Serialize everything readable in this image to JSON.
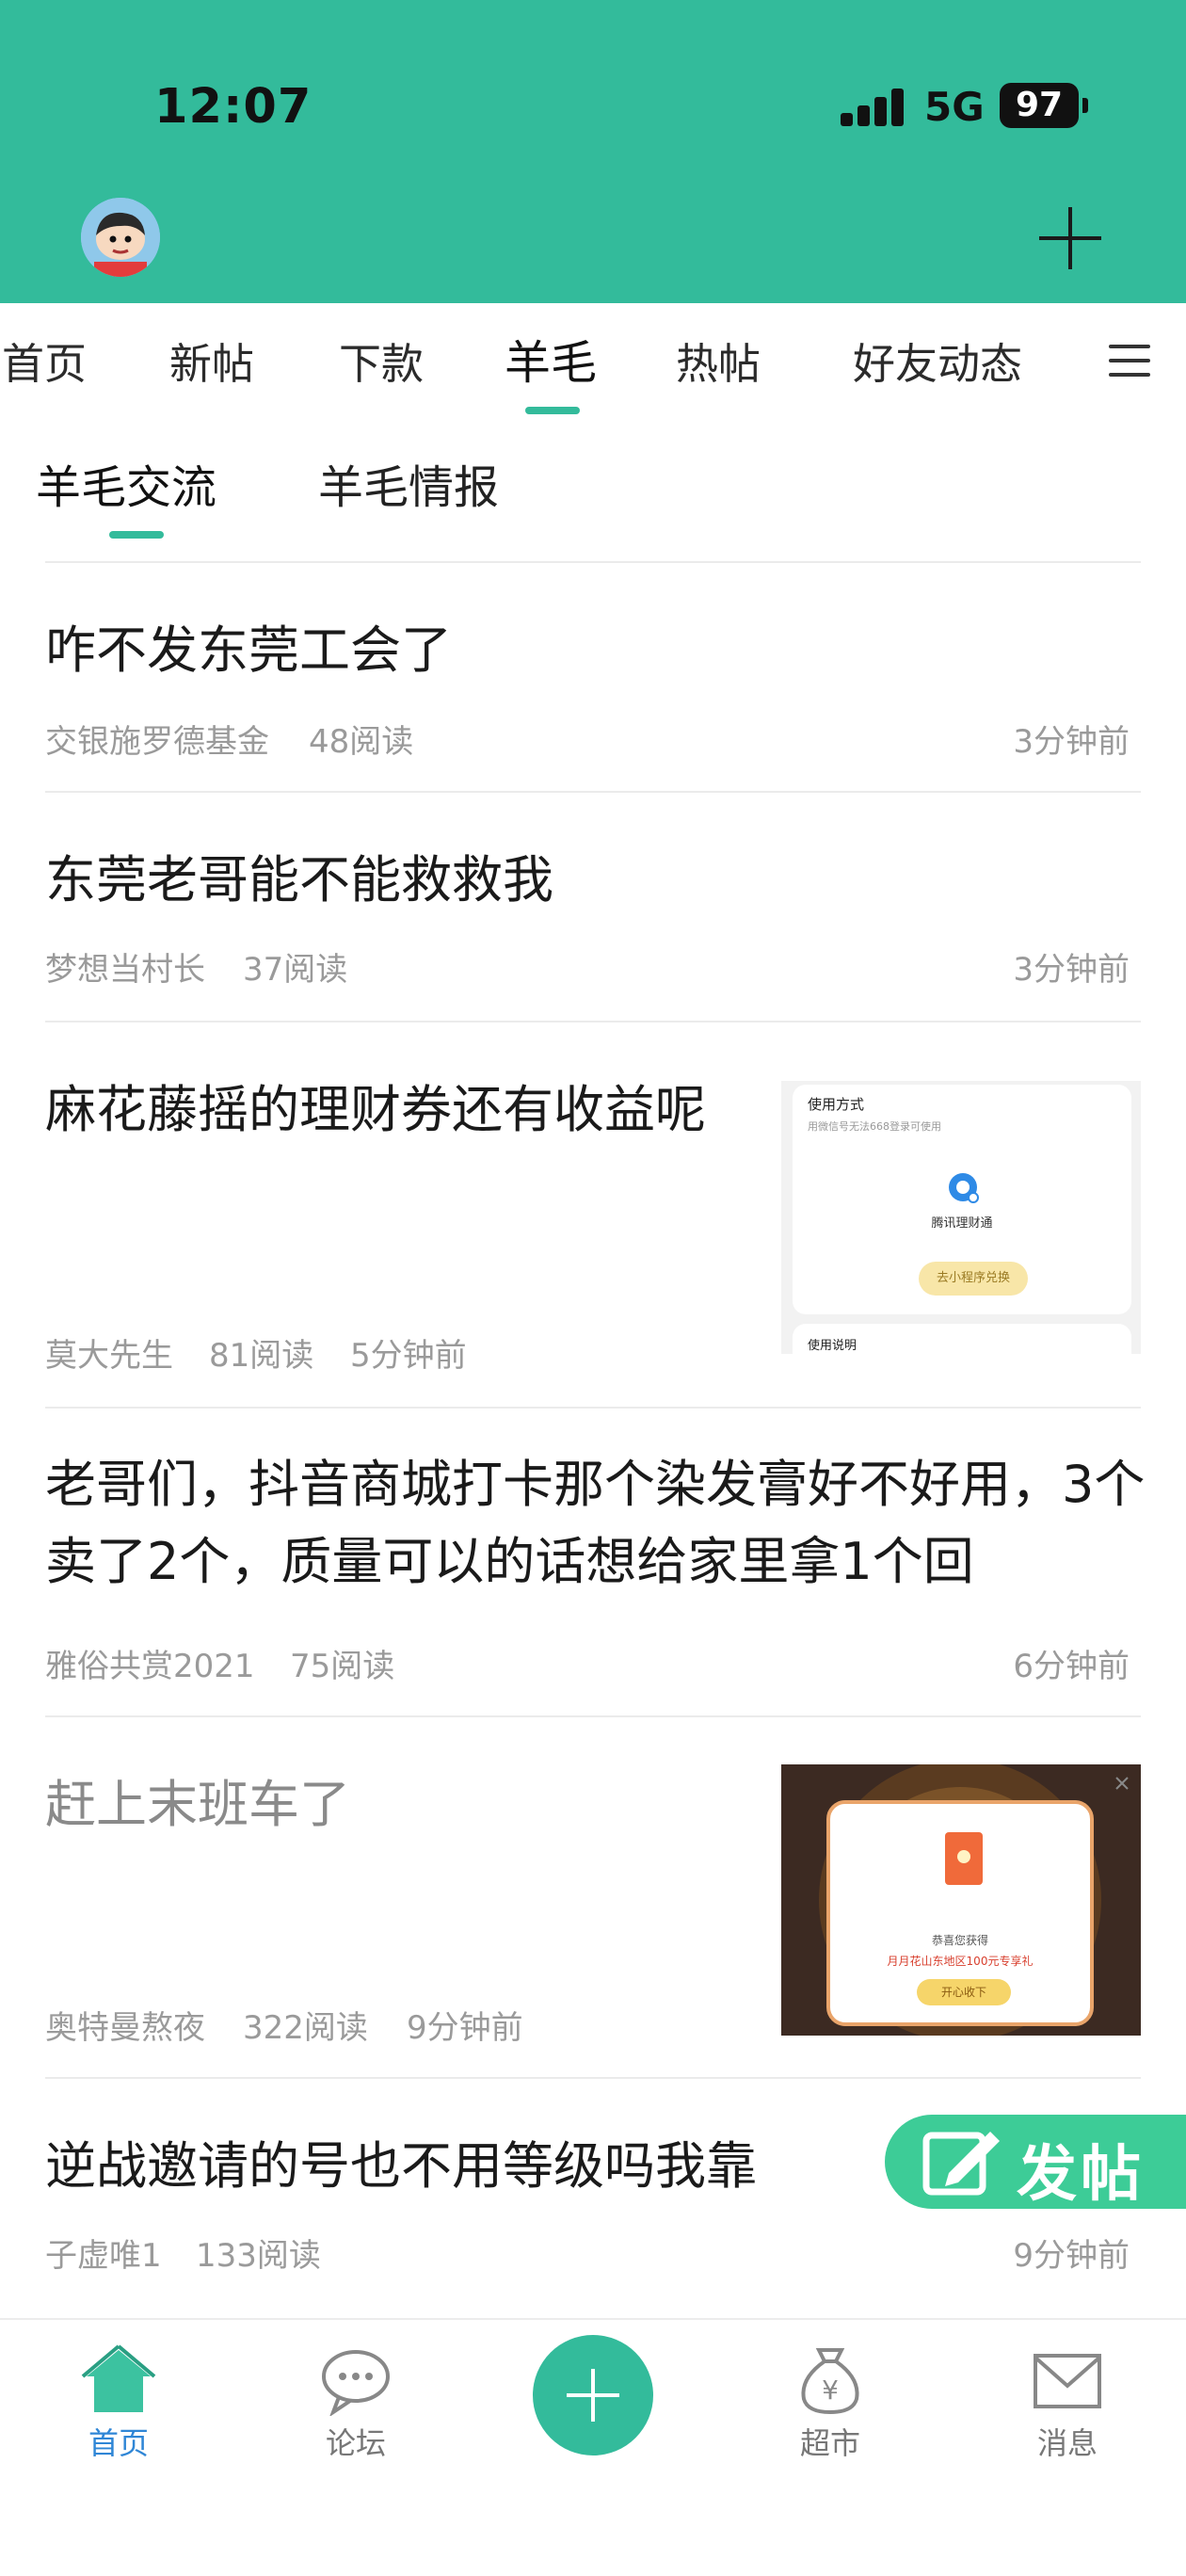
{
  "status_bar": {
    "time": "12:07",
    "network": "5G",
    "battery": "97"
  },
  "header": {
    "avatar_icon": "cartoon-avatar",
    "add_icon": "plus-icon",
    "color": "#33bb9b"
  },
  "nav": {
    "tabs": [
      "首页",
      "新帖",
      "下款",
      "羊毛",
      "热帖",
      "好友动态"
    ],
    "active": "羊毛",
    "menu_icon": "hamburger-icon"
  },
  "subtabs": {
    "items": [
      "羊毛交流",
      "羊毛情报"
    ],
    "active": "羊毛交流"
  },
  "posts": [
    {
      "title": "咋不发东莞工会了",
      "author": "交银施罗德基金",
      "reads": "48阅读",
      "time": "3分钟前"
    },
    {
      "title": "东莞老哥能不能救救我",
      "author": "梦想当村长",
      "reads": "37阅读",
      "time": "3分钟前"
    },
    {
      "title": "麻花藤摇的理财券还有收益呢",
      "author": "莫大先生",
      "reads": "81阅读",
      "time": "5分钟前",
      "thumbnail": {
        "heading": "使用方式",
        "desc": "用微信号无法668登录可使用",
        "app": "腾讯理财通",
        "button": "去小程序兑换",
        "footer": "使用说明"
      }
    },
    {
      "title": "老哥们，抖音商城打卡那个染发膏好不好用，3个卖了2个，质量可以的话想给家里拿1个回",
      "author": "雅俗共赏2021",
      "reads": "75阅读",
      "time": "6分钟前"
    },
    {
      "title": "赶上末班车了",
      "author": "奥特曼熬夜",
      "reads": "322阅读",
      "time": "9分钟前",
      "read_state": "visited",
      "thumbnail": {
        "line1": "恭喜您获得",
        "line2": "月月花山东地区100元专享礼",
        "button": "开心收下"
      }
    },
    {
      "title": "逆战邀请的号也不用等级吗我靠",
      "author": "子虚唯1",
      "reads": "133阅读",
      "time": "9分钟前"
    }
  ],
  "fab": {
    "label": "发帖",
    "icon": "edit-icon",
    "color": "#3dcc97"
  },
  "tabbar": {
    "items": [
      {
        "label": "首页",
        "icon": "home-icon"
      },
      {
        "label": "论坛",
        "icon": "chat-bubble-icon"
      },
      {
        "label": "",
        "icon": "plus-icon"
      },
      {
        "label": "超市",
        "icon": "money-bag-icon"
      },
      {
        "label": "消息",
        "icon": "mail-icon"
      }
    ],
    "active": "首页",
    "active_color": "#2f86d6"
  }
}
